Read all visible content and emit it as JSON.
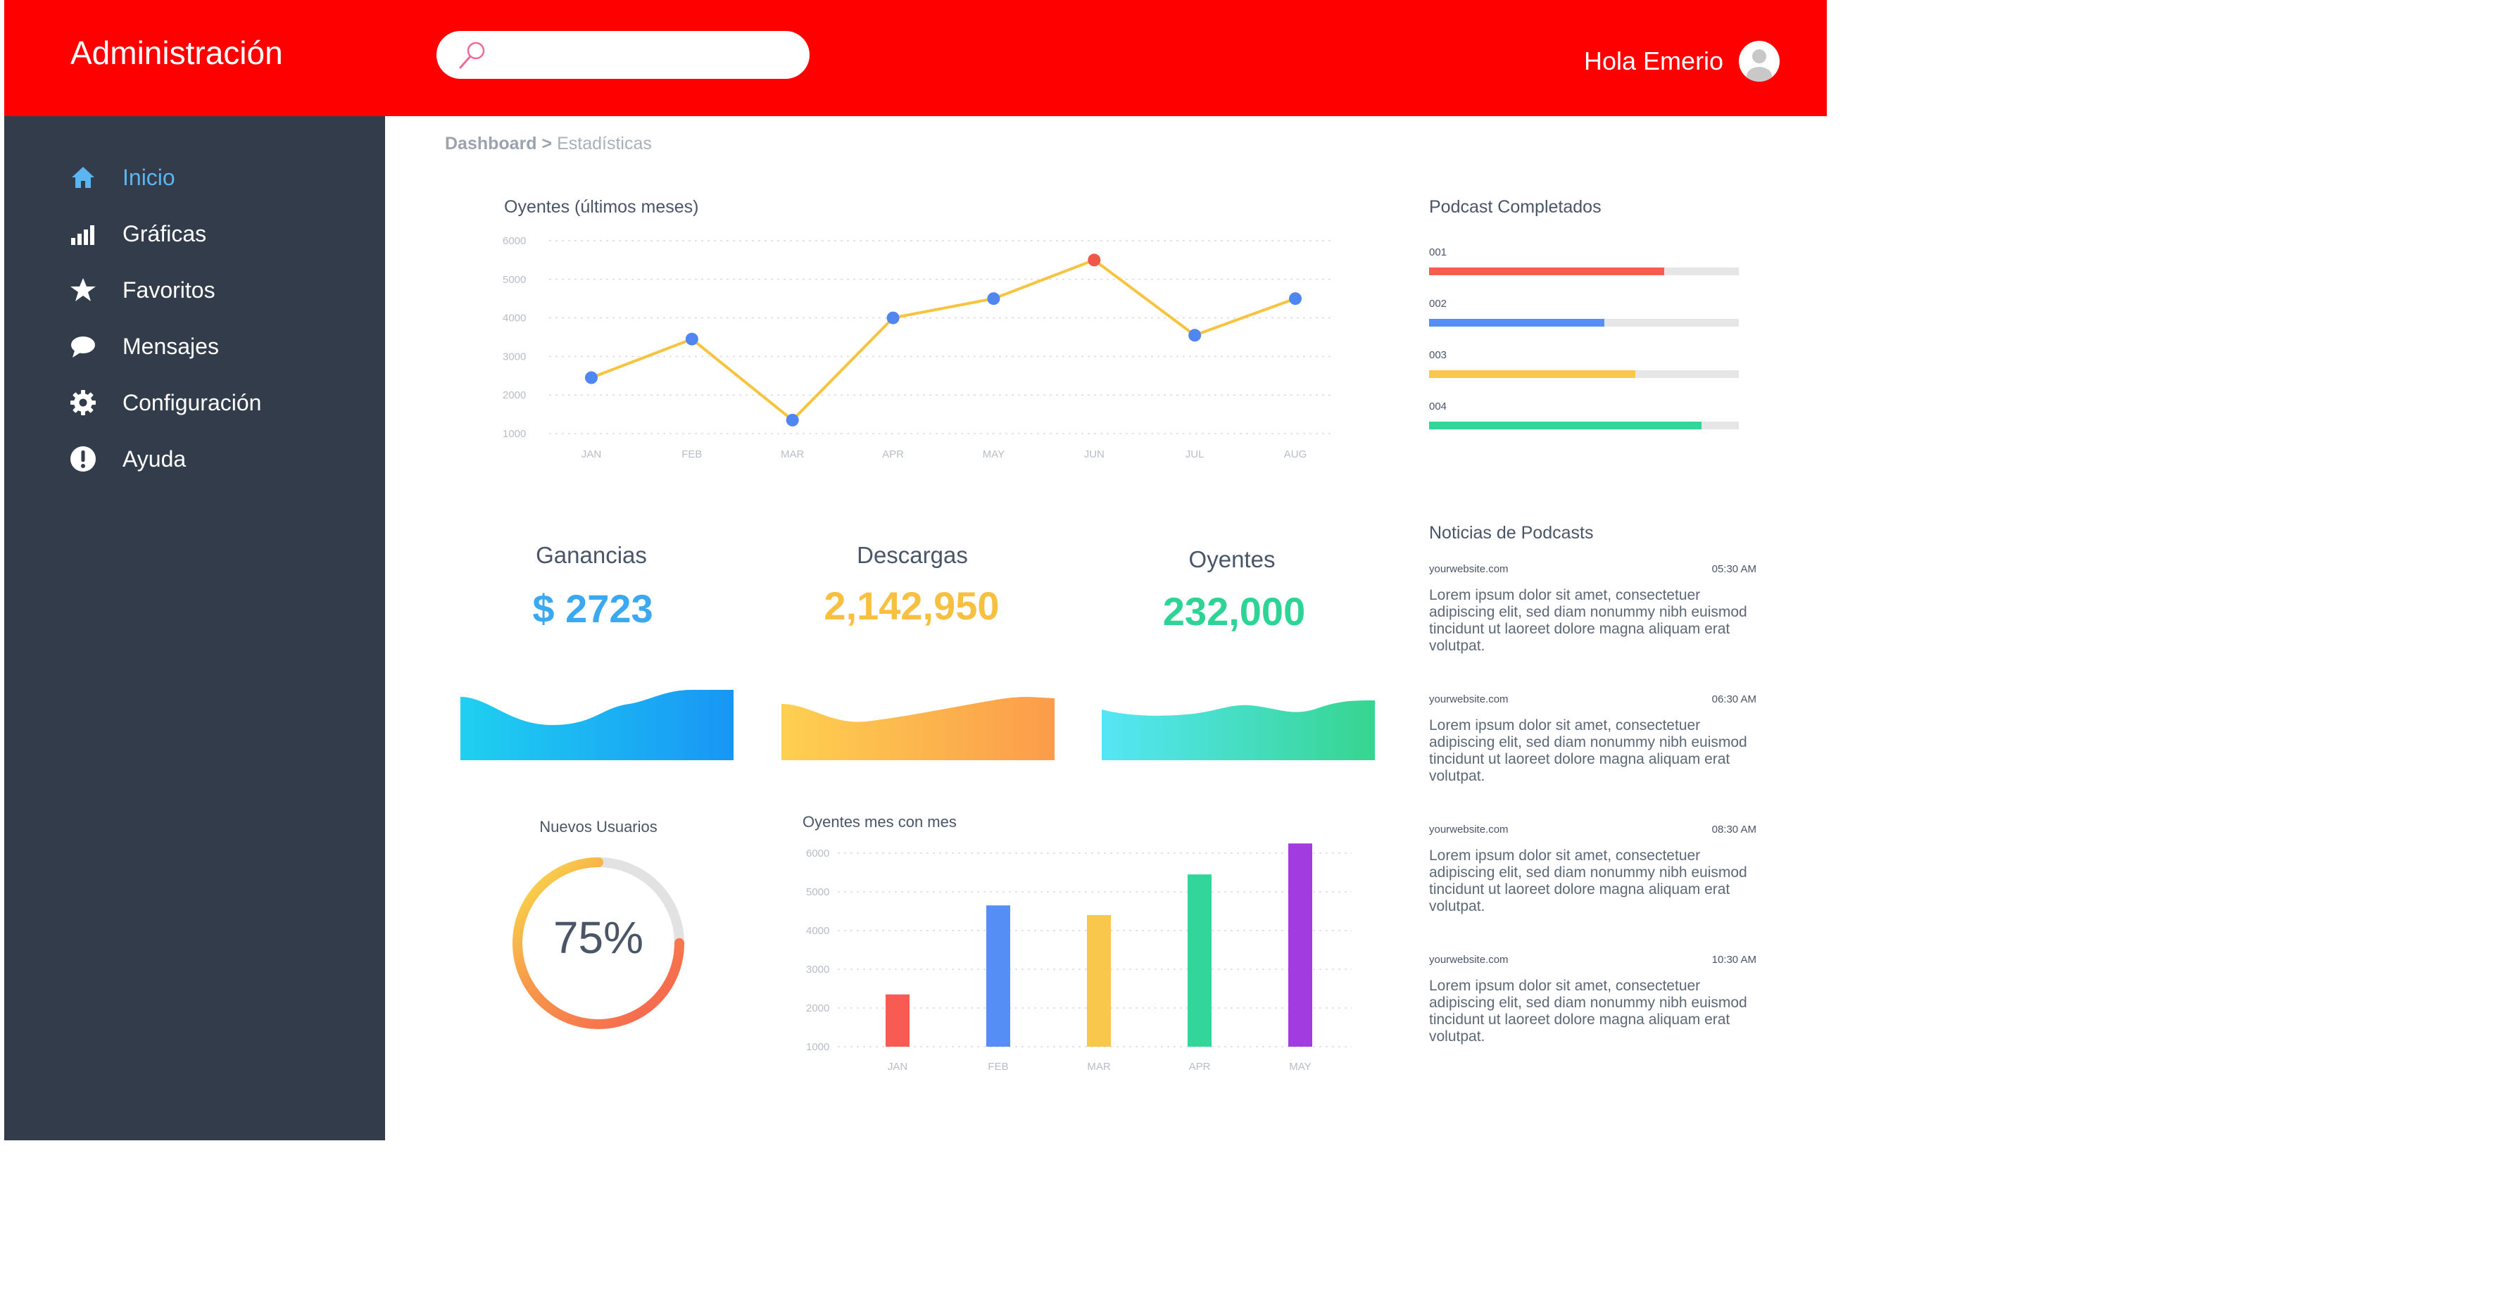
{
  "header": {
    "app_title": "Administración",
    "search_placeholder": "",
    "greeting": "Hola Emerio"
  },
  "sidebar": {
    "items": [
      {
        "label": "Inicio",
        "icon": "home-icon",
        "active": true
      },
      {
        "label": "Gráficas",
        "icon": "bar-chart-icon",
        "active": false
      },
      {
        "label": "Favoritos",
        "icon": "star-icon",
        "active": false
      },
      {
        "label": "Mensajes",
        "icon": "chat-bubble-icon",
        "active": false
      },
      {
        "label": "Configuración",
        "icon": "gear-icon",
        "active": false
      },
      {
        "label": "Ayuda",
        "icon": "alert-icon",
        "active": false
      }
    ]
  },
  "breadcrumb": {
    "root": "Dashboard",
    "separator": ">",
    "current": "Estadísticas"
  },
  "line_chart": {
    "title": "Oyentes (últimos meses)",
    "chart_data": {
      "type": "line",
      "categories": [
        "JAN",
        "FEB",
        "MAR",
        "APR",
        "MAY",
        "JUN",
        "JUL",
        "AUG"
      ],
      "values": [
        2450,
        3450,
        1350,
        4000,
        4500,
        5500,
        3550,
        4500
      ],
      "highlight_index": 5,
      "ylim": [
        1000,
        6000
      ],
      "yticks": [
        "6000",
        "5000",
        "4000",
        "3000",
        "2000",
        "1000"
      ],
      "line_color": "#f8c440",
      "point_color": "#4f86f0",
      "highlight_color": "#f0574b",
      "grid": true
    }
  },
  "progress": {
    "title": "Podcast Completados",
    "items": [
      {
        "label": "001",
        "value": 0.76,
        "color": "#f75b52"
      },
      {
        "label": "002",
        "value": 0.565,
        "color": "#558ef4"
      },
      {
        "label": "003",
        "value": 0.665,
        "color": "#f8c74b"
      },
      {
        "label": "004",
        "value": 0.88,
        "color": "#33d69a"
      }
    ]
  },
  "stats": [
    {
      "label": "Ganancias",
      "value": "$ 2723",
      "color": "#3aa9f2"
    },
    {
      "label": "Descargas",
      "value": "2,142,950",
      "color": "#f8c040"
    },
    {
      "label": "Oyentes",
      "value": "232,000",
      "color": "#2ed496"
    }
  ],
  "donut": {
    "title": "Nuevos Usuarios",
    "value_text": "75%",
    "fraction": 0.75
  },
  "bar_chart": {
    "title": "Oyentes mes con mes",
    "chart_data": {
      "type": "bar",
      "categories": [
        "JAN",
        "FEB",
        "MAR",
        "APR",
        "MAY"
      ],
      "values": [
        2350,
        4650,
        4400,
        5450,
        6250
      ],
      "colors": [
        "#f75b52",
        "#558ef4",
        "#f8c74b",
        "#33d69a",
        "#a33ce0"
      ],
      "ylim": [
        1000,
        6000
      ],
      "yticks": [
        "6000",
        "5000",
        "4000",
        "3000",
        "2000",
        "1000"
      ],
      "grid": true
    }
  },
  "news": {
    "title": "Noticias de Podcasts",
    "items": [
      {
        "source": "yourwebsite.com",
        "time": "05:30 AM",
        "body": "Lorem ipsum dolor sit amet, consectetuer adipiscing elit, sed diam nonummy nibh euismod tincidunt ut laoreet dolore magna aliquam erat volutpat."
      },
      {
        "source": "yourwebsite.com",
        "time": "06:30 AM",
        "body": "Lorem ipsum dolor sit amet, consectetuer adipiscing elit, sed diam nonummy nibh euismod tincidunt ut laoreet dolore magna aliquam erat volutpat."
      },
      {
        "source": "yourwebsite.com",
        "time": "08:30 AM",
        "body": "Lorem ipsum dolor sit amet, consectetuer adipiscing elit, sed diam nonummy nibh euismod tincidunt ut laoreet dolore magna aliquam erat volutpat."
      },
      {
        "source": "yourwebsite.com",
        "time": "10:30 AM",
        "body": "Lorem ipsum dolor sit amet, consectetuer adipiscing elit, sed diam nonummy nibh euismod tincidunt ut laoreet dolore magna aliquam erat volutpat."
      }
    ]
  }
}
